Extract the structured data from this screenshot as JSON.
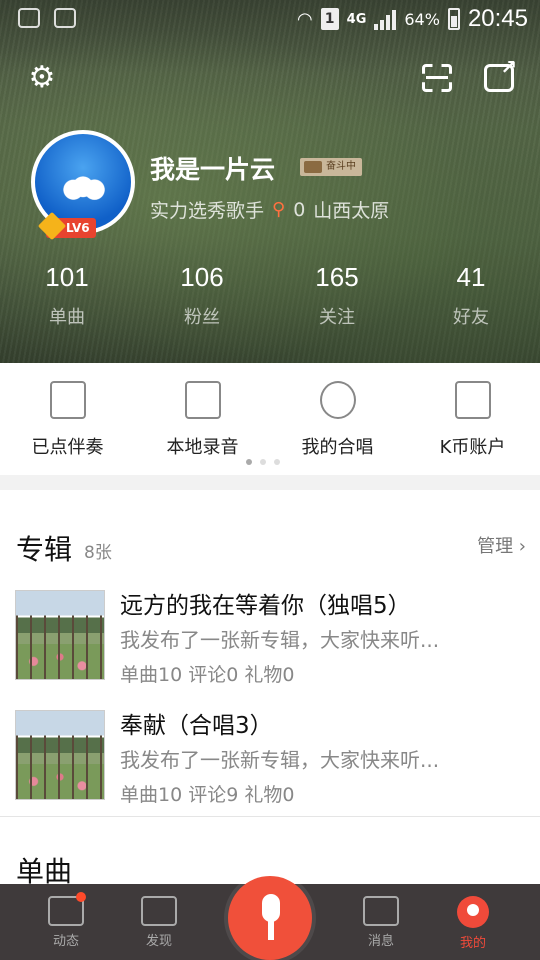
{
  "statusbar": {
    "sim": "1",
    "network": "4G",
    "battery": "64%",
    "time": "20:45"
  },
  "profile": {
    "nickname": "我是一片云",
    "rank_badge": "奋斗中",
    "level": "LV6",
    "title": "实力选秀歌手",
    "flowers": "0",
    "location": "山西太原"
  },
  "stats": [
    {
      "num": "101",
      "label": "单曲"
    },
    {
      "num": "106",
      "label": "粉丝"
    },
    {
      "num": "165",
      "label": "关注"
    },
    {
      "num": "41",
      "label": "好友"
    }
  ],
  "quick_actions": [
    {
      "label": "已点伴奏",
      "icon": "checklist-icon"
    },
    {
      "label": "本地录音",
      "icon": "music-note-icon"
    },
    {
      "label": "我的合唱",
      "icon": "chorus-icon"
    },
    {
      "label": "K币账户",
      "icon": "wallet-icon"
    }
  ],
  "albums": {
    "title": "专辑",
    "count": "8张",
    "manage": "管理 ›",
    "items": [
      {
        "title": "远方的我在等着你（独唱5）",
        "desc": "我发布了一张新专辑，大家快来听...",
        "meta": "单曲10 评论0 礼物0"
      },
      {
        "title": "奉献（合唱3）",
        "desc": "我发布了一张新专辑，大家快来听...",
        "meta": "单曲10 评论9 礼物0"
      }
    ]
  },
  "singles": {
    "title": "单曲"
  },
  "tabbar": [
    {
      "label": "动态",
      "icon": "chat-icon"
    },
    {
      "label": "发现",
      "icon": "crown-icon"
    },
    {
      "label": "消息",
      "icon": "envelope-icon"
    },
    {
      "label": "我的",
      "icon": "profile-icon"
    }
  ],
  "colors": {
    "accent": "#f04a3a",
    "tabbar_bg": "#3f3a3b"
  }
}
